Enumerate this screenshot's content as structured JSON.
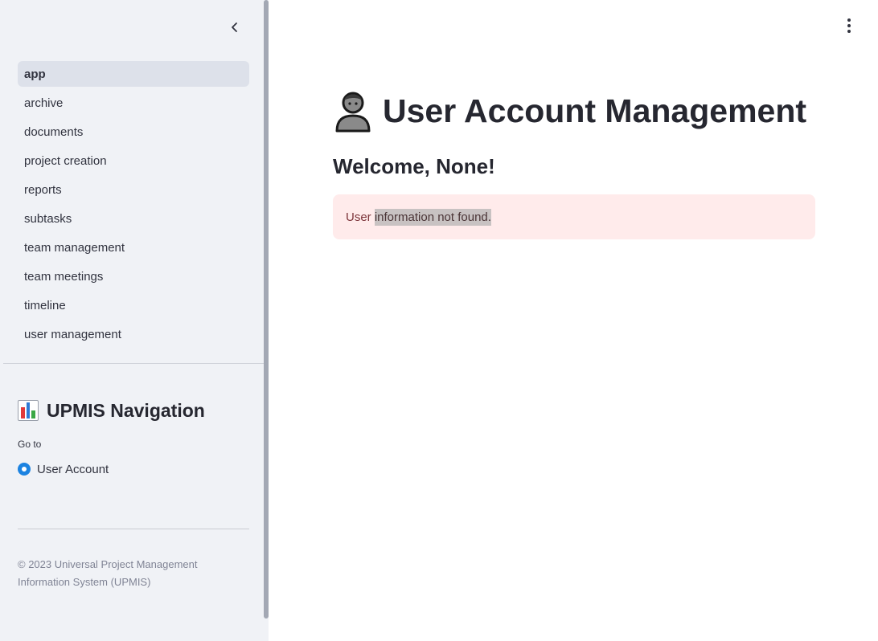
{
  "sidebar": {
    "nav_items": [
      {
        "label": "app",
        "active": true
      },
      {
        "label": "archive"
      },
      {
        "label": "documents"
      },
      {
        "label": "project creation"
      },
      {
        "label": "reports"
      },
      {
        "label": "subtasks"
      },
      {
        "label": "team management"
      },
      {
        "label": "team meetings"
      },
      {
        "label": "timeline"
      },
      {
        "label": "user management"
      }
    ],
    "title": "UPMIS Navigation",
    "title_icon": "bar-chart-icon",
    "goto_label": "Go to",
    "radio_option": "User Account",
    "footer": "© 2023 Universal Project Management Information System (UPMIS)"
  },
  "main": {
    "title": "User Account Management",
    "title_icon": "user-icon",
    "welcome": "Welcome, None!",
    "alert_prefix": "User ",
    "alert_highlight": "information not found."
  },
  "colors": {
    "sidebar_bg": "#f0f2f6",
    "active_nav_bg": "#dde1ea",
    "radio_accent": "#1c83e1",
    "alert_bg": "#ffebeb",
    "alert_text": "#7d353b"
  }
}
